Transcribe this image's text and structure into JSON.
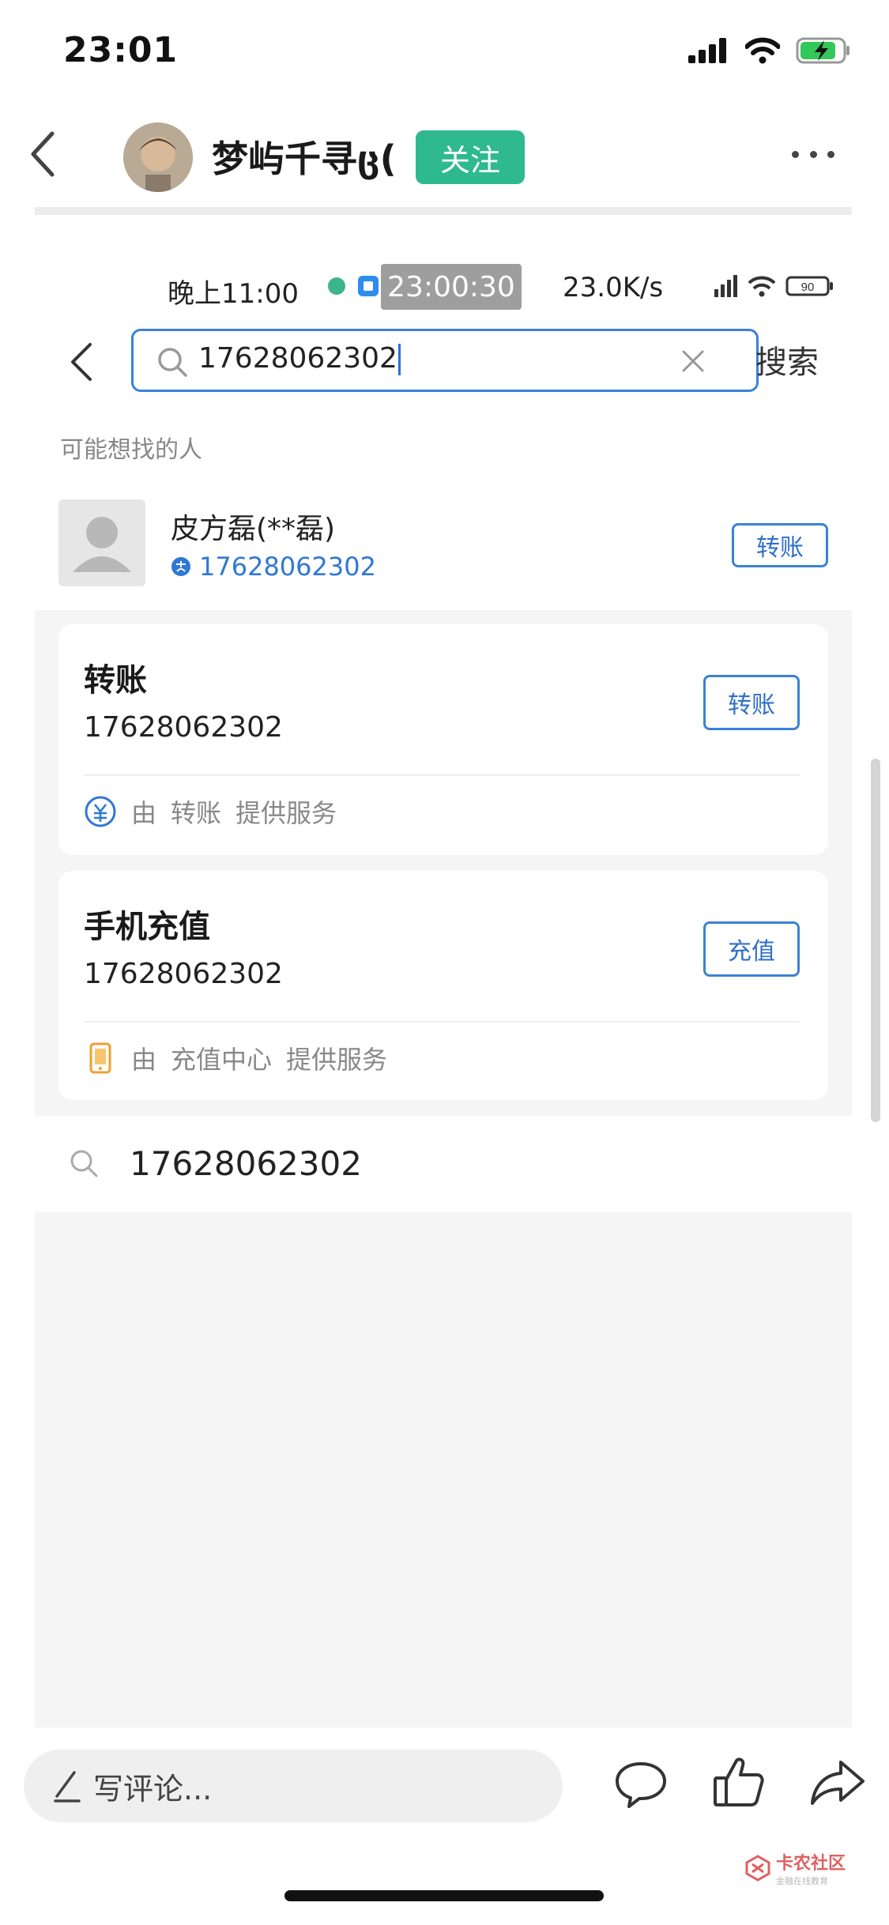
{
  "status_bar": {
    "time": "23:01"
  },
  "nav": {
    "author_name": "梦屿千寻ც(",
    "follow_label": "关注"
  },
  "embedded": {
    "status": {
      "time": "晚上11:00",
      "timer": "23:00:30",
      "speed": "23.0K/s",
      "battery": "90"
    },
    "search": {
      "value": "17628062302",
      "submit_label": "搜索"
    },
    "section_label": "可能想找的人",
    "person": {
      "name": "皮方磊(**磊)",
      "phone": "17628062302",
      "action_label": "转账"
    },
    "cards": [
      {
        "title": "转账",
        "number": "17628062302",
        "action_label": "转账",
        "footer_prefix": "由",
        "footer_provider": "转账",
        "footer_suffix": "提供服务"
      },
      {
        "title": "手机充值",
        "number": "17628062302",
        "action_label": "充值",
        "footer_prefix": "由",
        "footer_provider": "充值中心",
        "footer_suffix": "提供服务"
      }
    ],
    "suggestion": "17628062302"
  },
  "bottom_bar": {
    "comment_placeholder": "写评论..."
  },
  "watermark": {
    "text": "卡农社区",
    "sub": "金融在线教育"
  },
  "colors": {
    "accent": "#2fb98e",
    "link_blue": "#2f78d4"
  }
}
